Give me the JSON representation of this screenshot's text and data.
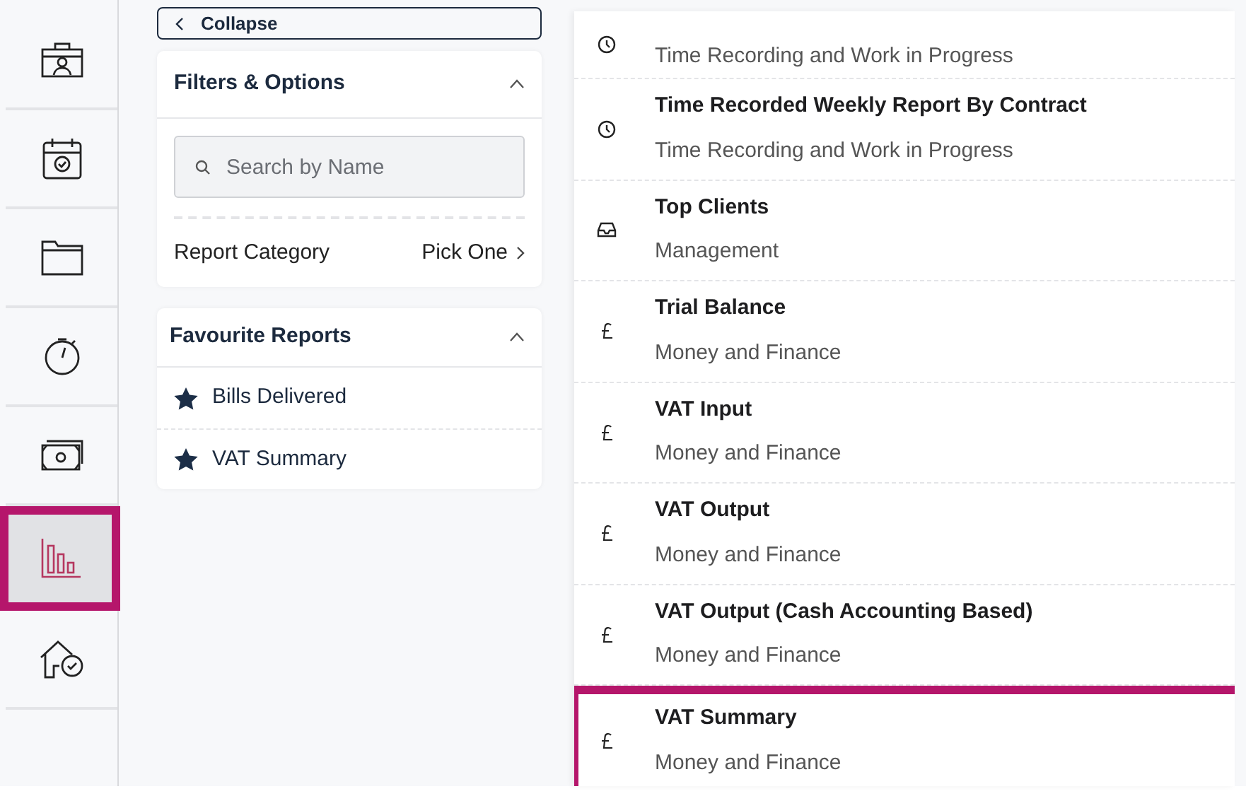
{
  "rail": [
    {
      "kind": "briefcase",
      "selected": false
    },
    {
      "kind": "calendar",
      "selected": false
    },
    {
      "kind": "folder",
      "selected": false
    },
    {
      "kind": "stopwatch",
      "selected": false
    },
    {
      "kind": "cash",
      "selected": false
    },
    {
      "kind": "chart",
      "selected": true
    },
    {
      "kind": "house",
      "selected": false
    }
  ],
  "collapse_button": {
    "label": "Collapse"
  },
  "filters": {
    "title": "Filters & Options",
    "expanded": true,
    "search": {
      "placeholder": "Search by Name"
    },
    "category": {
      "label": "Report Category",
      "value": "Pick One"
    }
  },
  "favourites": {
    "title": "Favourite Reports",
    "expanded": true,
    "items": [
      {
        "label": "Bills Delivered"
      },
      {
        "label": "VAT Summary"
      }
    ]
  },
  "reports": [
    {
      "category": "Time Recording and Work in Progress",
      "kind": "clock",
      "selected": false
    },
    {
      "title": "Time Recorded Weekly Report By Contract",
      "category": "Time Recording and Work in Progress",
      "kind": "clock",
      "selected": false
    },
    {
      "title": "Top Clients",
      "category": "Management",
      "kind": "tray",
      "selected": false
    },
    {
      "title": "Trial Balance",
      "category": "Money and Finance",
      "kind": "pound",
      "selected": false
    },
    {
      "title": "VAT Input",
      "category": "Money and Finance",
      "kind": "pound",
      "selected": false
    },
    {
      "title": "VAT Output",
      "category": "Money and Finance",
      "kind": "pound",
      "selected": false
    },
    {
      "title": "VAT Output (Cash Accounting Based)",
      "category": "Money and Finance",
      "kind": "pound",
      "selected": false
    },
    {
      "title": "VAT Summary",
      "category": "Money and Finance",
      "kind": "pound",
      "selected": true
    }
  ]
}
